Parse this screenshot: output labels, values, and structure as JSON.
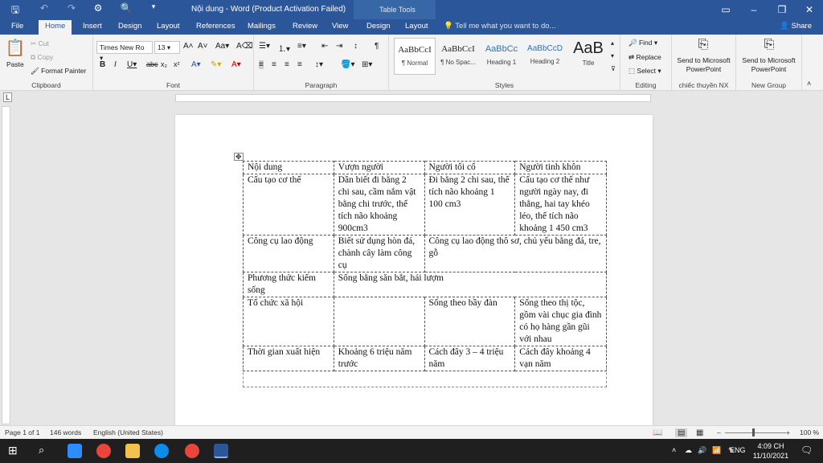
{
  "window": {
    "title": "Nội dung - Word (Product Activation Failed)",
    "context_tab_group": "Table Tools"
  },
  "tabs": [
    "File",
    "Home",
    "Insert",
    "Design",
    "Layout",
    "References",
    "Mailings",
    "Review",
    "View",
    "Design",
    "Layout"
  ],
  "tell_me": "Tell me what you want to do...",
  "share": "Share",
  "ribbon": {
    "clipboard": {
      "paste": "Paste",
      "cut": "Cut",
      "copy": "Copy",
      "format_painter": "Format Painter",
      "label": "Clipboard"
    },
    "font": {
      "family": "Times New Ro",
      "size": "13",
      "label": "Font"
    },
    "paragraph": {
      "label": "Paragraph"
    },
    "styles": {
      "items": [
        {
          "preview": "AaBbCcI",
          "name": "¶ Normal"
        },
        {
          "preview": "AaBbCcI",
          "name": "¶ No Spac..."
        },
        {
          "preview": "AaBbCc",
          "name": "Heading 1"
        },
        {
          "preview": "AaBbCcD",
          "name": "Heading 2"
        },
        {
          "preview": "AaB",
          "name": "Title"
        }
      ],
      "label": "Styles"
    },
    "editing": {
      "find": "Find",
      "replace": "Replace",
      "select": "Select",
      "label": "Editing"
    },
    "send1": {
      "line1": "Send to Microsoft",
      "line2": "PowerPoint",
      "label": "chiếc thuyền NX"
    },
    "send2": {
      "line1": "Send to Microsoft",
      "line2": "PowerPoint",
      "label": "New Group"
    }
  },
  "table": {
    "header": [
      "Nội dung",
      "Vượn người",
      "Người tối cổ",
      "Người tinh khôn"
    ],
    "rows": [
      {
        "c0": "Cấu tạo cơ thể",
        "c1": "Dần biết đi bằng 2 chi sau, cầm nắm vật bằng chi trước, thể tích não khoảng 900cm3",
        "c2": "Đi bằng 2 chi sau, thể tích não khoảng 1 100 cm3",
        "c3": "Cấu tạo cơ thể như người ngày nay, đi thẳng, hai tay khéo léo, thể tích não khoảng 1 450 cm3"
      },
      {
        "c0": "Công cụ lao động",
        "c1": "Biết sử dụng hòn đá, chành cây làm công cụ",
        "c23": "Công cụ lao động thô sơ, chủ yếu bằng đá, tre, gỗ"
      },
      {
        "c0": "Phương thức kiếm sống",
        "c123": "Sống bằng săn bắt, hái lượm"
      },
      {
        "c0": "Tổ chức xã hội",
        "c1": "",
        "c2": "Sống theo bầy đàn",
        "c3": "Sống theo thị tộc, gồm vài chục gia đình có họ hàng gần gũi với nhau"
      },
      {
        "c0": "Thời gian xuất hiện",
        "c1": "Khoảng 6 triệu năm trước",
        "c2": "Cách đây 3 – 4 triệu năm",
        "c3": "Cách đây khoảng 4 vạn năm"
      }
    ]
  },
  "status": {
    "page": "Page 1 of 1",
    "words": "146 words",
    "lang": "English (United States)",
    "zoom": "100 %"
  },
  "taskbar": {
    "time": "4:09 CH",
    "date": "11/10/2021",
    "lang": "ENG"
  },
  "colors": {
    "accent": "#2b579a",
    "tabletools": "#3867a8"
  }
}
